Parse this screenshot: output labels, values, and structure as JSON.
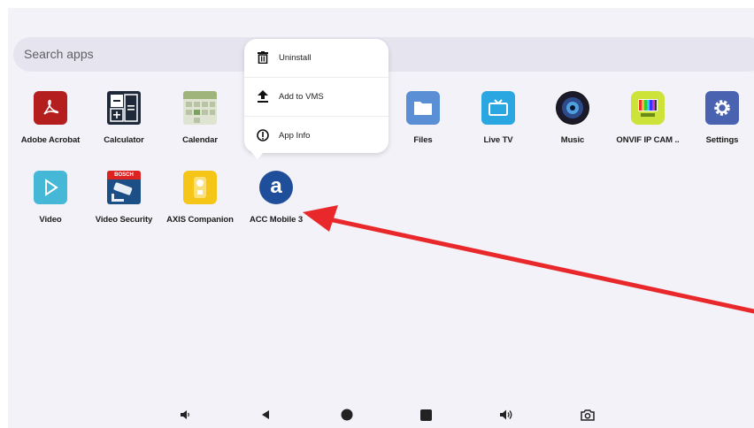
{
  "search": {
    "placeholder": "Search apps"
  },
  "apps_row1": [
    {
      "label": "Adobe Acrobat",
      "icon": "adobe-acrobat-icon"
    },
    {
      "label": "Calculator",
      "icon": "calculator-icon"
    },
    {
      "label": "Calendar",
      "icon": "calendar-icon"
    },
    {
      "label": "Files",
      "icon": "files-icon"
    },
    {
      "label": "Live TV",
      "icon": "live-tv-icon"
    },
    {
      "label": "Music",
      "icon": "music-icon"
    },
    {
      "label": "ONVIF IP CAM ..",
      "icon": "onvif-ip-cam-icon"
    },
    {
      "label": "Settings",
      "icon": "settings-icon"
    }
  ],
  "apps_row2": [
    {
      "label": "Video",
      "icon": "video-icon"
    },
    {
      "label": "Video Security",
      "icon": "video-security-icon",
      "badge": "BOSCH"
    },
    {
      "label": "AXIS Companion",
      "icon": "axis-companion-icon"
    },
    {
      "label": "ACC Mobile 3",
      "icon": "acc-mobile-icon",
      "glyph": "a"
    }
  ],
  "context_menu": {
    "items": [
      {
        "label": "Uninstall",
        "icon": "trash-icon"
      },
      {
        "label": "Add to VMS",
        "icon": "upload-icon"
      },
      {
        "label": "App Info",
        "icon": "info-icon"
      }
    ]
  },
  "nav_bar": [
    "volume-down-icon",
    "back-icon",
    "home-icon",
    "recents-icon",
    "volume-up-icon",
    "camera-icon"
  ],
  "colors": {
    "annotation_arrow": "#e8282b",
    "background": "#f3f2f8",
    "search_bg": "#e6e4ef"
  }
}
